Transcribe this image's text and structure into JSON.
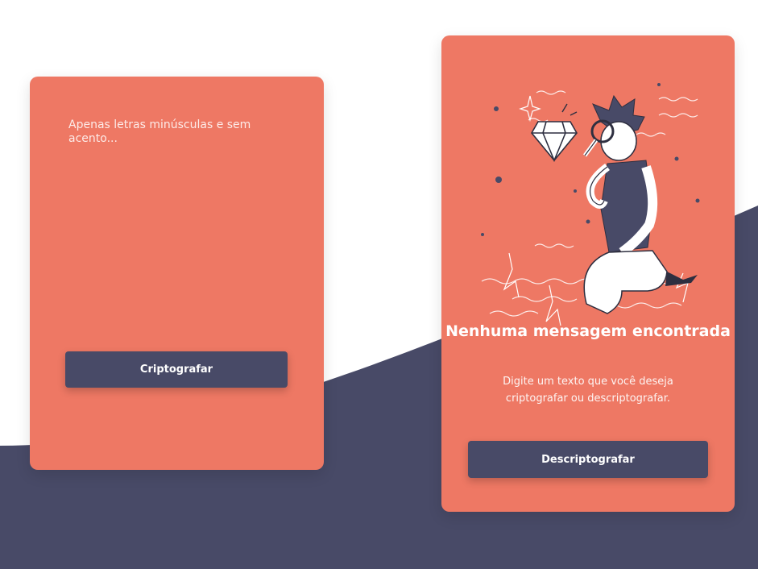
{
  "encrypt_panel": {
    "placeholder": "Apenas letras minúsculas e sem acento...",
    "value": "",
    "encrypt_label": "Criptografar"
  },
  "result_panel": {
    "empty_title": "Nenhuma mensagem encontrada",
    "empty_text": "Digite um texto que você deseja criptografar ou descriptografar.",
    "decrypt_label": "Descriptografar",
    "illustration": "person-with-magnifier-and-diamond"
  },
  "colors": {
    "background": "#ffffff",
    "wave": "#484a67",
    "card": "#ee7864",
    "button": "#484a67",
    "text": "#ffffff"
  }
}
